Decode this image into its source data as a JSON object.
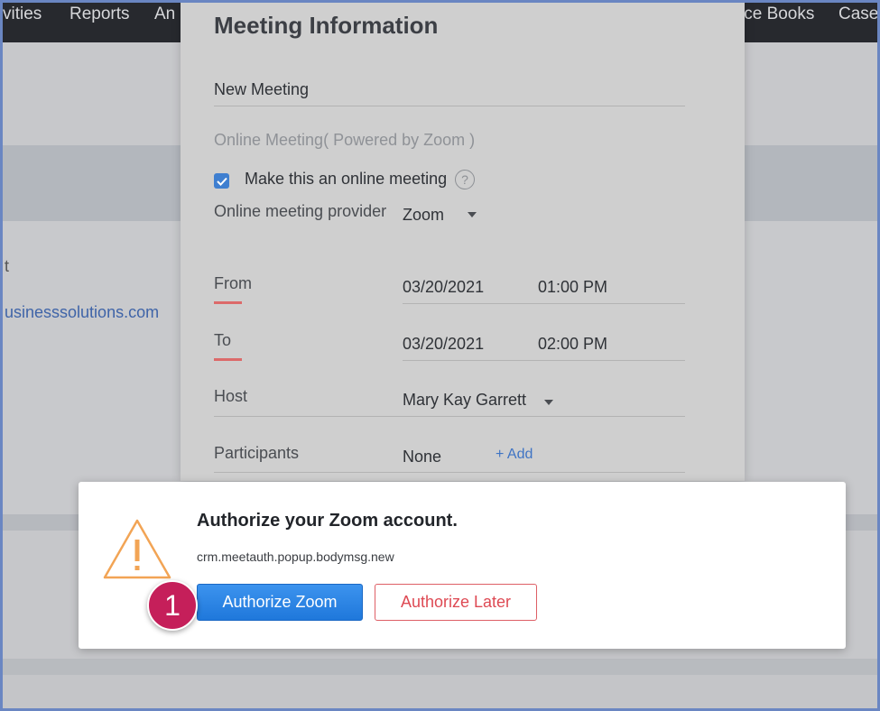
{
  "topnav": {
    "items": [
      "vities",
      "Reports",
      "An",
      "ice Books",
      "Case"
    ]
  },
  "background": {
    "tick_glyph": "t",
    "email_fragment": "usinesssolutions.com"
  },
  "meeting_panel": {
    "title": "Meeting Information",
    "meeting_title_value": "New Meeting",
    "location_placeholder": "Online Meeting( Powered by Zoom )",
    "online_checkbox_label": "Make this an online meeting",
    "online_checkbox_checked": true,
    "help_glyph": "?",
    "provider_label": "Online meeting provider",
    "provider_value": "Zoom",
    "from_label": "From",
    "from_date": "03/20/2021",
    "from_time": "01:00 PM",
    "to_label": "To",
    "to_date": "03/20/2021",
    "to_time": "02:00 PM",
    "host_label": "Host",
    "host_value": "Mary Kay Garrett",
    "participants_label": "Participants",
    "participants_value": "None",
    "add_link": "+ Add"
  },
  "dialog": {
    "title": "Authorize your Zoom account.",
    "message": "crm.meetauth.popup.bodymsg.new",
    "primary_button": "Authorize Zoom",
    "secondary_button": "Authorize Later",
    "icon": "warning-icon"
  },
  "annotation": {
    "step_number": "1"
  },
  "colors": {
    "primary": "#1f78db",
    "danger": "#de4a54",
    "warning": "#f2a455",
    "badge": "#c51f5a",
    "nav_bg": "#27292e"
  }
}
